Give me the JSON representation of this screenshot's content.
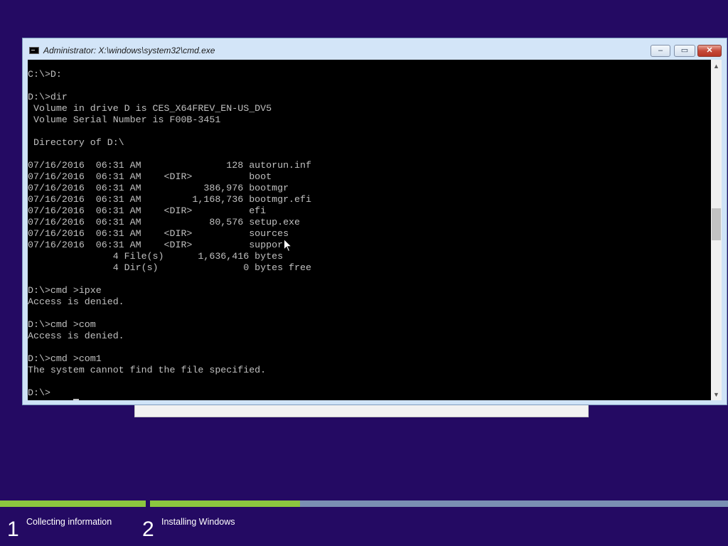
{
  "window": {
    "title": "Administrator: X:\\windows\\system32\\cmd.exe",
    "minimize_glyph": "–",
    "maximize_glyph": "▭",
    "close_glyph": "✕",
    "icon": "console-icon"
  },
  "console": {
    "lines": [
      "C:\\>D:",
      "",
      "D:\\>dir",
      " Volume in drive D is CES_X64FREV_EN-US_DV5",
      " Volume Serial Number is F00B-3451",
      "",
      " Directory of D:\\",
      "",
      "07/16/2016  06:31 AM               128 autorun.inf",
      "07/16/2016  06:31 AM    <DIR>          boot",
      "07/16/2016  06:31 AM           386,976 bootmgr",
      "07/16/2016  06:31 AM         1,168,736 bootmgr.efi",
      "07/16/2016  06:31 AM    <DIR>          efi",
      "07/16/2016  06:31 AM            80,576 setup.exe",
      "07/16/2016  06:31 AM    <DIR>          sources",
      "07/16/2016  06:31 AM    <DIR>          support",
      "               4 File(s)      1,636,416 bytes",
      "               4 Dir(s)               0 bytes free",
      "",
      "D:\\>cmd >ipxe",
      "Access is denied.",
      "",
      "D:\\>cmd >com",
      "Access is denied.",
      "",
      "D:\\>cmd >com1",
      "The system cannot find the file specified.",
      "",
      "D:\\>"
    ]
  },
  "scrollbar": {
    "up_glyph": "▲",
    "down_glyph": "▼",
    "position": 0.46
  },
  "setup": {
    "steps": [
      {
        "number": "1",
        "label": "Collecting information",
        "progress": 1.0
      },
      {
        "number": "2",
        "label": "Installing Windows",
        "progress": 0.26
      }
    ]
  },
  "colors": {
    "desktop": "#240a63",
    "console_bg": "#000000",
    "console_fg": "#c0c0c0",
    "progress_done": "#8cc63f",
    "progress_track": "#7a8fb3"
  }
}
